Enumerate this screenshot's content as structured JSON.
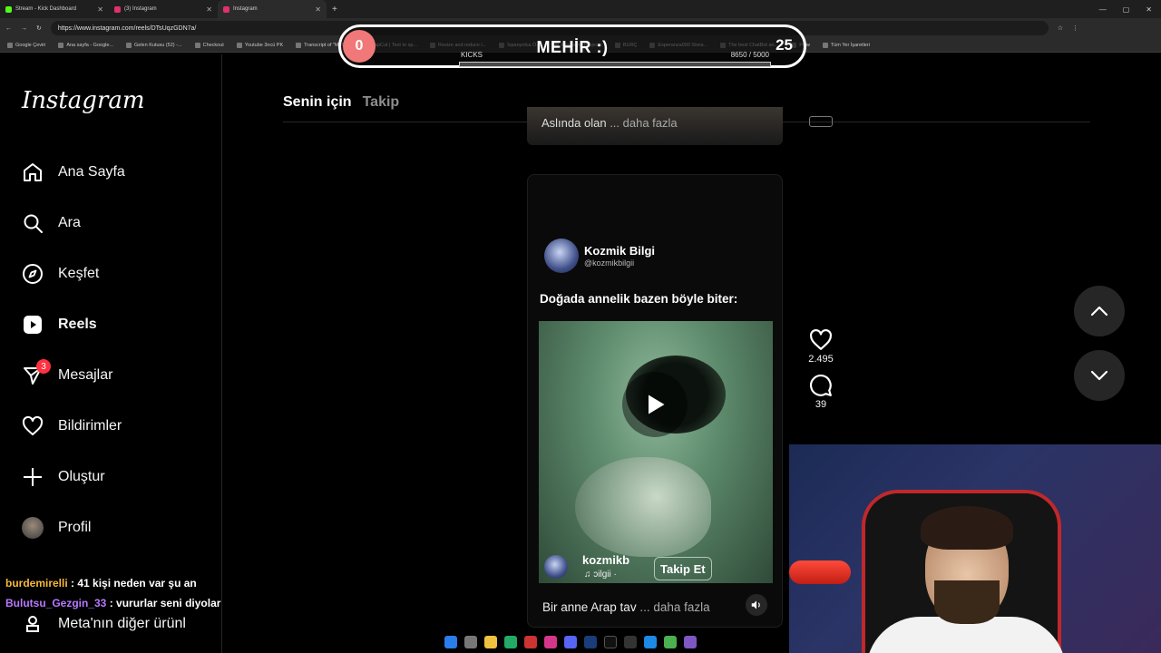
{
  "browser": {
    "tabs": [
      {
        "label": "Stream - Kick Dashboard",
        "color": "#53fc18"
      },
      {
        "label": "(3) Instagram",
        "color": "#e1306c"
      },
      {
        "label": "Instagram",
        "color": "#e1306c"
      }
    ],
    "url": "https://www.instagram.com/reels/DTsUqzGDN7a/",
    "bookmarks": [
      "Google Çeviri",
      "Ana sayfa - Google...",
      "Gelen Kutusu (52) -...",
      "Checkout",
      "Youtube 3ncü PK",
      "Transcript of \"MI M...",
      "CapCut | Text to sp...",
      "Resize and reduce i...",
      "İspanyolca Ö...",
      "HeyGen - Projects",
      "BURÇ",
      "Esperanza000 Strea...",
      "The best ChatBot an...",
      "Flow",
      "Tüm Yer İşaretleri"
    ]
  },
  "kick_overlay": {
    "left_count": "0",
    "title": "MEHİR :)",
    "right_count": "25",
    "label": "KICKS",
    "progress_text": "8650 / 5000",
    "progress_fraction": 1.0
  },
  "sidebar": {
    "logo": "Instagram",
    "items": [
      {
        "label": "Ana Sayfa",
        "icon": "home-icon"
      },
      {
        "label": "Ara",
        "icon": "search-icon"
      },
      {
        "label": "Keşfet",
        "icon": "compass-icon"
      },
      {
        "label": "Reels",
        "icon": "reels-icon"
      },
      {
        "label": "Mesajlar",
        "icon": "messenger-icon",
        "badge": "3"
      },
      {
        "label": "Bildirimler",
        "icon": "heart-icon"
      },
      {
        "label": "Oluştur",
        "icon": "plus-icon"
      },
      {
        "label": "Profil",
        "icon": "avatar"
      }
    ],
    "more_label": "Meta'nın diğer ürünl"
  },
  "feed": {
    "tab_active": "Senin için",
    "tab_inactive": "Takip",
    "prev_caption": "Aslında olan",
    "prev_more": "... daha fazla"
  },
  "reel": {
    "author_name": "Kozmik Bilgi",
    "author_handle": "@kozmikbilgii",
    "headline": "Doğada annelik bazen böyle biter:",
    "overlay_user": "kozmikb",
    "overlay_audio": "♫ ɔilgii ·",
    "follow_label": "Takip Et",
    "caption": "Bir anne Arap tav",
    "caption_more": "... daha fazla",
    "likes": "2.495",
    "comments": "39"
  },
  "chat": [
    {
      "user": "burdemirelli",
      "message": ": 41 kişi neden var şu an"
    },
    {
      "user": "Bulutsu_Gezgin_33",
      "message": ": vururlar seni diyolar"
    }
  ]
}
